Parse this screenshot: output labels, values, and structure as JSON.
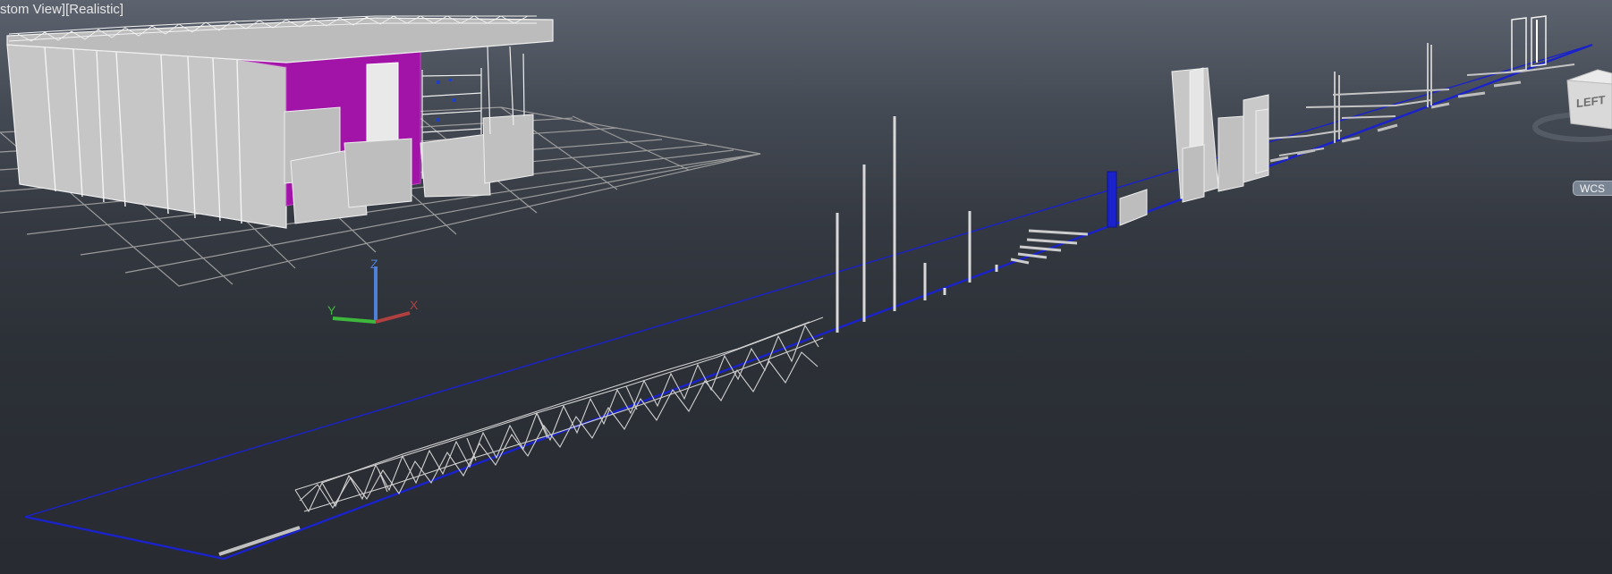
{
  "viewport": {
    "view_label": "stom View][Realistic]",
    "background_top": "#5c636e",
    "background_bottom": "#282b31"
  },
  "ucs_icon": {
    "x_label": "X",
    "y_label": "Y",
    "z_label": "Z"
  },
  "viewcube": {
    "face_label": "LEFT",
    "wcs_label": "WCS"
  },
  "colors": {
    "booth_wall": "#c8c8c8",
    "booth_accent": "#a213a8",
    "boundary_line": "#1a22cc",
    "grid": "#9a9a9a",
    "truss": "#cfcfcf",
    "x_axis": "#b04040",
    "y_axis": "#3db83d",
    "z_axis": "#4f7fd6"
  }
}
